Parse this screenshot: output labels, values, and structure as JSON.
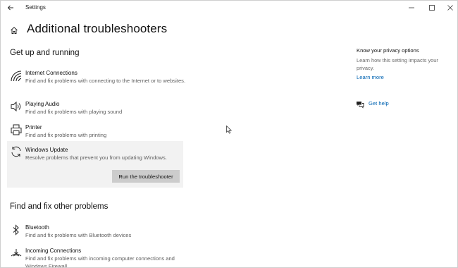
{
  "window": {
    "app_title": "Settings",
    "controls": {
      "minimize": "—",
      "maximize": "☐",
      "close": "✕"
    }
  },
  "page": {
    "title": "Additional troubleshooters"
  },
  "sections": [
    {
      "title": "Get up and running",
      "items": [
        {
          "name": "Internet Connections",
          "desc": "Find and fix problems with connecting to the Internet or to websites.",
          "icon": "wifi-icon"
        },
        {
          "name": "Playing Audio",
          "desc": "Find and fix problems with playing sound",
          "icon": "speaker-icon"
        },
        {
          "name": "Printer",
          "desc": "Find and fix problems with printing",
          "icon": "printer-icon"
        },
        {
          "name": "Windows Update",
          "desc": "Resolve problems that prevent you from updating Windows.",
          "icon": "refresh-icon",
          "button": "Run the troubleshooter"
        }
      ]
    },
    {
      "title": "Find and fix other problems",
      "items": [
        {
          "name": "Bluetooth",
          "desc": "Find and fix problems with Bluetooth devices",
          "icon": "bluetooth-icon"
        },
        {
          "name": "Incoming Connections",
          "desc": "Find and fix problems with incoming computer connections and Windows Firewall.",
          "icon": "incoming-connection-icon"
        }
      ]
    }
  ],
  "sidebar": {
    "privacy_title": "Know your privacy options",
    "privacy_desc": "Learn how this setting impacts your privacy.",
    "learn_more": "Learn more",
    "get_help": "Get help"
  },
  "colors": {
    "link": "#0063b1",
    "selected_bg": "#f2f2f2",
    "button_bg": "#cccccc"
  }
}
